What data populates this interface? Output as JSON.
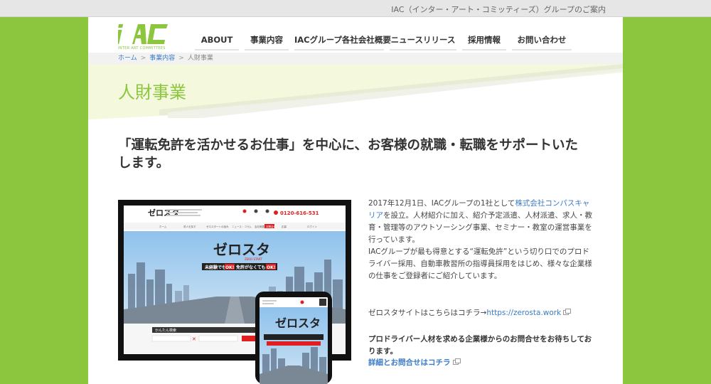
{
  "topbar": {
    "group_link": "IAC（インター・アート・コミッティーズ）グループのご案内"
  },
  "logo": {
    "mark": "iAC",
    "sub": "INTER ART COMMITTEES"
  },
  "nav": {
    "items": [
      {
        "label": "ABOUT"
      },
      {
        "label": "事業内容"
      },
      {
        "label": "IACグループ各社会社概要"
      },
      {
        "label": "ニュースリリース"
      },
      {
        "label": "採用情報"
      },
      {
        "label": "お問い合わせ"
      }
    ]
  },
  "breadcrumb": {
    "home": "ホーム",
    "sep": ">",
    "business": "事業内容",
    "current": "人財事業"
  },
  "page_title": "人財事業",
  "lead": "「運転免許を活かせるお仕事」を中心に、お客様の就職・転職をサポートいたします。",
  "mock": {
    "brand": "ゼロスタ",
    "brand_sub": "ZERO START",
    "phone_number": "0120-616-531",
    "tagline_prefix": "未経験でも",
    "tagline_ok1": "OK!",
    "tagline_mid": "免許がなくても",
    "tagline_ok2": "OK!",
    "search_title": "かんたん検索",
    "menu": [
      "ホーム",
      "求人を探す",
      "ゼロスタートの強み",
      "ニュース・コラム",
      "会社概要",
      "お問合せ",
      "応募",
      "ログイン"
    ],
    "colors": {
      "red": "#e02020",
      "sky": "#6aa8d8",
      "dark": "#333333"
    }
  },
  "body": {
    "p1_before_link": "2017年12月1日、IACグループの1社として",
    "p1_link": "株式会社コンパスキャリア",
    "p1_after_link": "を設立。人材紹介に加え、紹介予定派遣、人材派遣、求人・教育・管理等のアウトソーシング事業、セミナー・教室の運営事業を行っています。",
    "p2": "IACグループが最も得意とする“運転免許”という切り口でのプロドライバー採用、自動車教習所の指導員採用をはじめ、様々な企業様の仕事をご登録者にご紹介しています。",
    "zerosta_text": "ゼロスタサイトはこちらはコチラ→",
    "zerosta_link": "https://zerosta.work",
    "driver_text": "プロドライバー人材を求める企業様からのお問合せをお待ちしております。",
    "contact_link": "詳細とお問合せはコチラ"
  },
  "colors": {
    "brand_green": "#8cc63f",
    "link_blue": "#3a7bc8",
    "text": "#333333"
  }
}
